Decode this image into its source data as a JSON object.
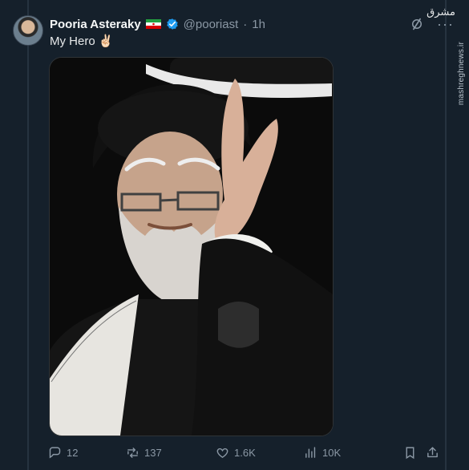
{
  "tweet": {
    "display_name": "Pooria Asteraky",
    "handle": "@pooriast",
    "separator": "·",
    "time": "1h",
    "text": "My Hero",
    "emoji": "✌🏻"
  },
  "watermark": {
    "logo": "مشرق",
    "site": "mashreghnews.ir"
  },
  "actions": {
    "replies": "12",
    "reposts": "137",
    "likes": "1.6K",
    "views": "10K"
  },
  "colors": {
    "background": "#15202b",
    "text": "#e7e9ea",
    "muted": "#8b98a5",
    "verified": "#1d9bf0"
  },
  "icons": {
    "verified": "verified-badge-icon",
    "grok": "grok-icon",
    "more": "more-icon",
    "reply": "reply-icon",
    "repost": "repost-icon",
    "like": "heart-icon",
    "views": "views-icon",
    "bookmark": "bookmark-icon",
    "share": "share-icon"
  }
}
